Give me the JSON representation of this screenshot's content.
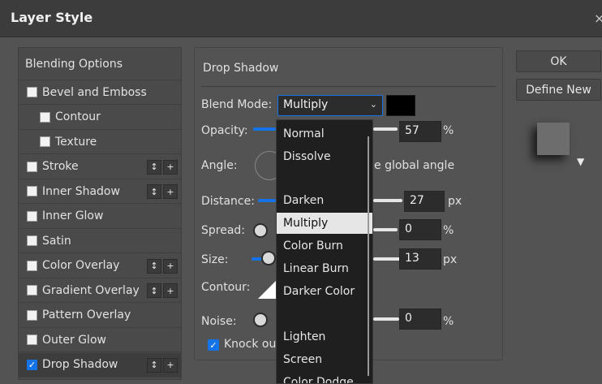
{
  "window": {
    "title": "Layer Style",
    "close_glyph": "×"
  },
  "styles_list": {
    "header": "Blending Options",
    "items": [
      {
        "label": "Bevel and Emboss",
        "checked": false,
        "indent": false,
        "has_buttons": false
      },
      {
        "label": "Contour",
        "checked": false,
        "indent": true,
        "has_buttons": false
      },
      {
        "label": "Texture",
        "checked": false,
        "indent": true,
        "has_buttons": false
      },
      {
        "label": "Stroke",
        "checked": false,
        "indent": false,
        "has_buttons": true
      },
      {
        "label": "Inner Shadow",
        "checked": false,
        "indent": false,
        "has_buttons": true
      },
      {
        "label": "Inner Glow",
        "checked": false,
        "indent": false,
        "has_buttons": false
      },
      {
        "label": "Satin",
        "checked": false,
        "indent": false,
        "has_buttons": false
      },
      {
        "label": "Color Overlay",
        "checked": false,
        "indent": false,
        "has_buttons": true
      },
      {
        "label": "Gradient Overlay",
        "checked": false,
        "indent": false,
        "has_buttons": true
      },
      {
        "label": "Pattern Overlay",
        "checked": false,
        "indent": false,
        "has_buttons": false
      },
      {
        "label": "Outer Glow",
        "checked": false,
        "indent": false,
        "has_buttons": false
      },
      {
        "label": "Drop Shadow",
        "checked": true,
        "indent": false,
        "has_buttons": true
      }
    ],
    "btn_move": "↕",
    "btn_add": "+"
  },
  "drop_shadow": {
    "section_title": "Drop Shadow",
    "blend_mode_label": "Blend Mode:",
    "blend_mode_value": "Multiply",
    "shadow_color": "#000000",
    "opacity_label": "Opacity:",
    "opacity_value": "57",
    "opacity_unit": "%",
    "angle_label": "Angle:",
    "global_angle_label_partial": "e global angle",
    "distance_label": "Distance:",
    "distance_value": "27",
    "distance_unit": "px",
    "spread_label": "Spread:",
    "spread_value": "0",
    "spread_unit": "%",
    "size_label": "Size:",
    "size_value": "13",
    "size_unit": "px",
    "contour_label": "Contour:",
    "noise_label": "Noise:",
    "noise_value": "0",
    "noise_unit": "%",
    "knockout_label_partial": "Knock ou"
  },
  "blend_menu": {
    "items": [
      "Normal",
      "Dissolve",
      "",
      "Darken",
      "Multiply",
      "Color Burn",
      "Linear Burn",
      "Darker Color",
      "",
      "Lighten",
      "Screen",
      "Color Dodge"
    ],
    "highlighted": "Multiply"
  },
  "buttons": {
    "ok": "OK",
    "define_new": "Define New"
  },
  "colors": {
    "accent": "#1473e6",
    "background": "#535353",
    "title_bar": "#3c3c3c"
  },
  "icons": {
    "dropdown_chevron": "chevron-down-icon",
    "preview_menu": "triangle-down-icon"
  }
}
